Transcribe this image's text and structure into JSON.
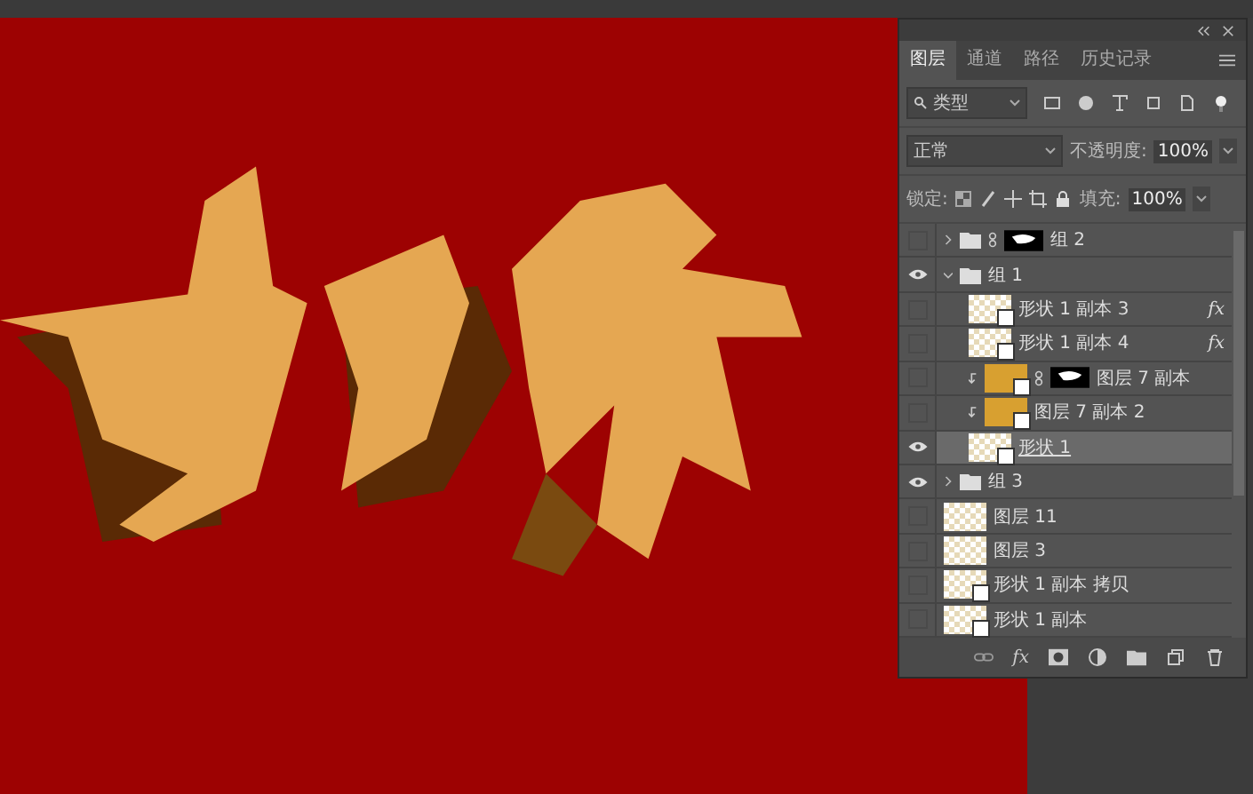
{
  "tabs": [
    {
      "label": "图层",
      "selected": true
    },
    {
      "label": "通道",
      "selected": false
    },
    {
      "label": "路径",
      "selected": false
    },
    {
      "label": "历史记录",
      "selected": false
    }
  ],
  "filter": {
    "value": "类型"
  },
  "blend_mode": {
    "value": "正常"
  },
  "opacity": {
    "label": "不透明度:",
    "value": "100%"
  },
  "lock": {
    "label": "锁定:"
  },
  "fill": {
    "label": "填充:",
    "value": "100%"
  },
  "layers": [
    {
      "kind": "group",
      "name": "组 2",
      "visible": false,
      "selected": false,
      "expanded": false,
      "mask": true
    },
    {
      "kind": "group",
      "name": "组 1",
      "visible": true,
      "selected": false,
      "expanded": true,
      "children": [
        {
          "kind": "shape",
          "name": "形状 1 副本 3",
          "visible": false,
          "selected": false,
          "effects": "fx"
        },
        {
          "kind": "shape",
          "name": "形状 1 副本 4",
          "visible": false,
          "selected": false,
          "effects": "fx"
        },
        {
          "kind": "fill",
          "name": "图层 7 副本",
          "visible": false,
          "selected": false,
          "clipped": true,
          "mask": true
        },
        {
          "kind": "fill",
          "name": "图层 7 副本 2",
          "visible": false,
          "selected": false,
          "clipped": true
        },
        {
          "kind": "shape",
          "name": "形状 1",
          "visible": true,
          "selected": true
        }
      ]
    },
    {
      "kind": "group",
      "name": "组 3",
      "visible": true,
      "selected": false,
      "expanded": false
    },
    {
      "kind": "raster",
      "name": "图层 11",
      "visible": false,
      "selected": false
    },
    {
      "kind": "raster",
      "name": "图层 3",
      "visible": false,
      "selected": false
    },
    {
      "kind": "shape",
      "name": "形状 1 副本 拷贝",
      "visible": false,
      "selected": false
    },
    {
      "kind": "shape",
      "name": "形状 1 副本",
      "visible": false,
      "selected": false
    }
  ],
  "footer": {
    "effects": "fx"
  }
}
